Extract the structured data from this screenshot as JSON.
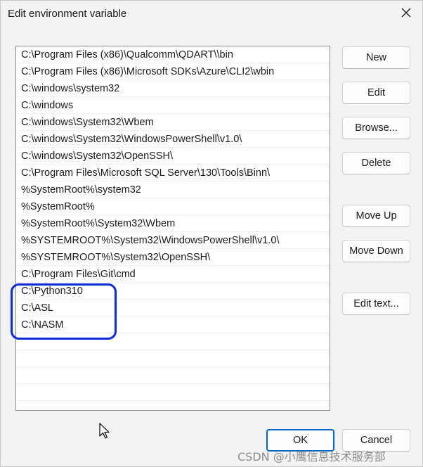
{
  "window": {
    "title": "Edit environment variable",
    "close_icon": "close-icon"
  },
  "path_list": {
    "items": [
      "C:\\Program Files (x86)\\Qualcomm\\QDART\\\\bin",
      "C:\\Program Files (x86)\\Microsoft SDKs\\Azure\\CLI2\\wbin",
      "C:\\windows\\system32",
      "C:\\windows",
      "C:\\windows\\System32\\Wbem",
      "C:\\windows\\System32\\WindowsPowerShell\\v1.0\\",
      "C:\\windows\\System32\\OpenSSH\\",
      "C:\\Program Files\\Microsoft SQL Server\\130\\Tools\\Binn\\",
      "%SystemRoot%\\system32",
      "%SystemRoot%",
      "%SystemRoot%\\System32\\Wbem",
      "%SYSTEMROOT%\\System32\\WindowsPowerShell\\v1.0\\",
      "%SYSTEMROOT%\\System32\\OpenSSH\\",
      "C:\\Program Files\\Git\\cmd",
      "C:\\Python310",
      "C:\\ASL",
      "C:\\NASM",
      "",
      "",
      "",
      ""
    ]
  },
  "buttons": {
    "new": "New",
    "edit": "Edit",
    "browse": "Browse...",
    "delete": "Delete",
    "move_up": "Move Up",
    "move_down": "Move Down",
    "edit_text": "Edit text...",
    "ok": "OK",
    "cancel": "Cancel"
  },
  "annotation": {
    "highlight_color": "#0a2bd6"
  },
  "watermark": "CSDN @小鹰信息技术服务部",
  "colors": {
    "accent": "#0067c0",
    "dialog_bg": "#f3f3f3"
  }
}
